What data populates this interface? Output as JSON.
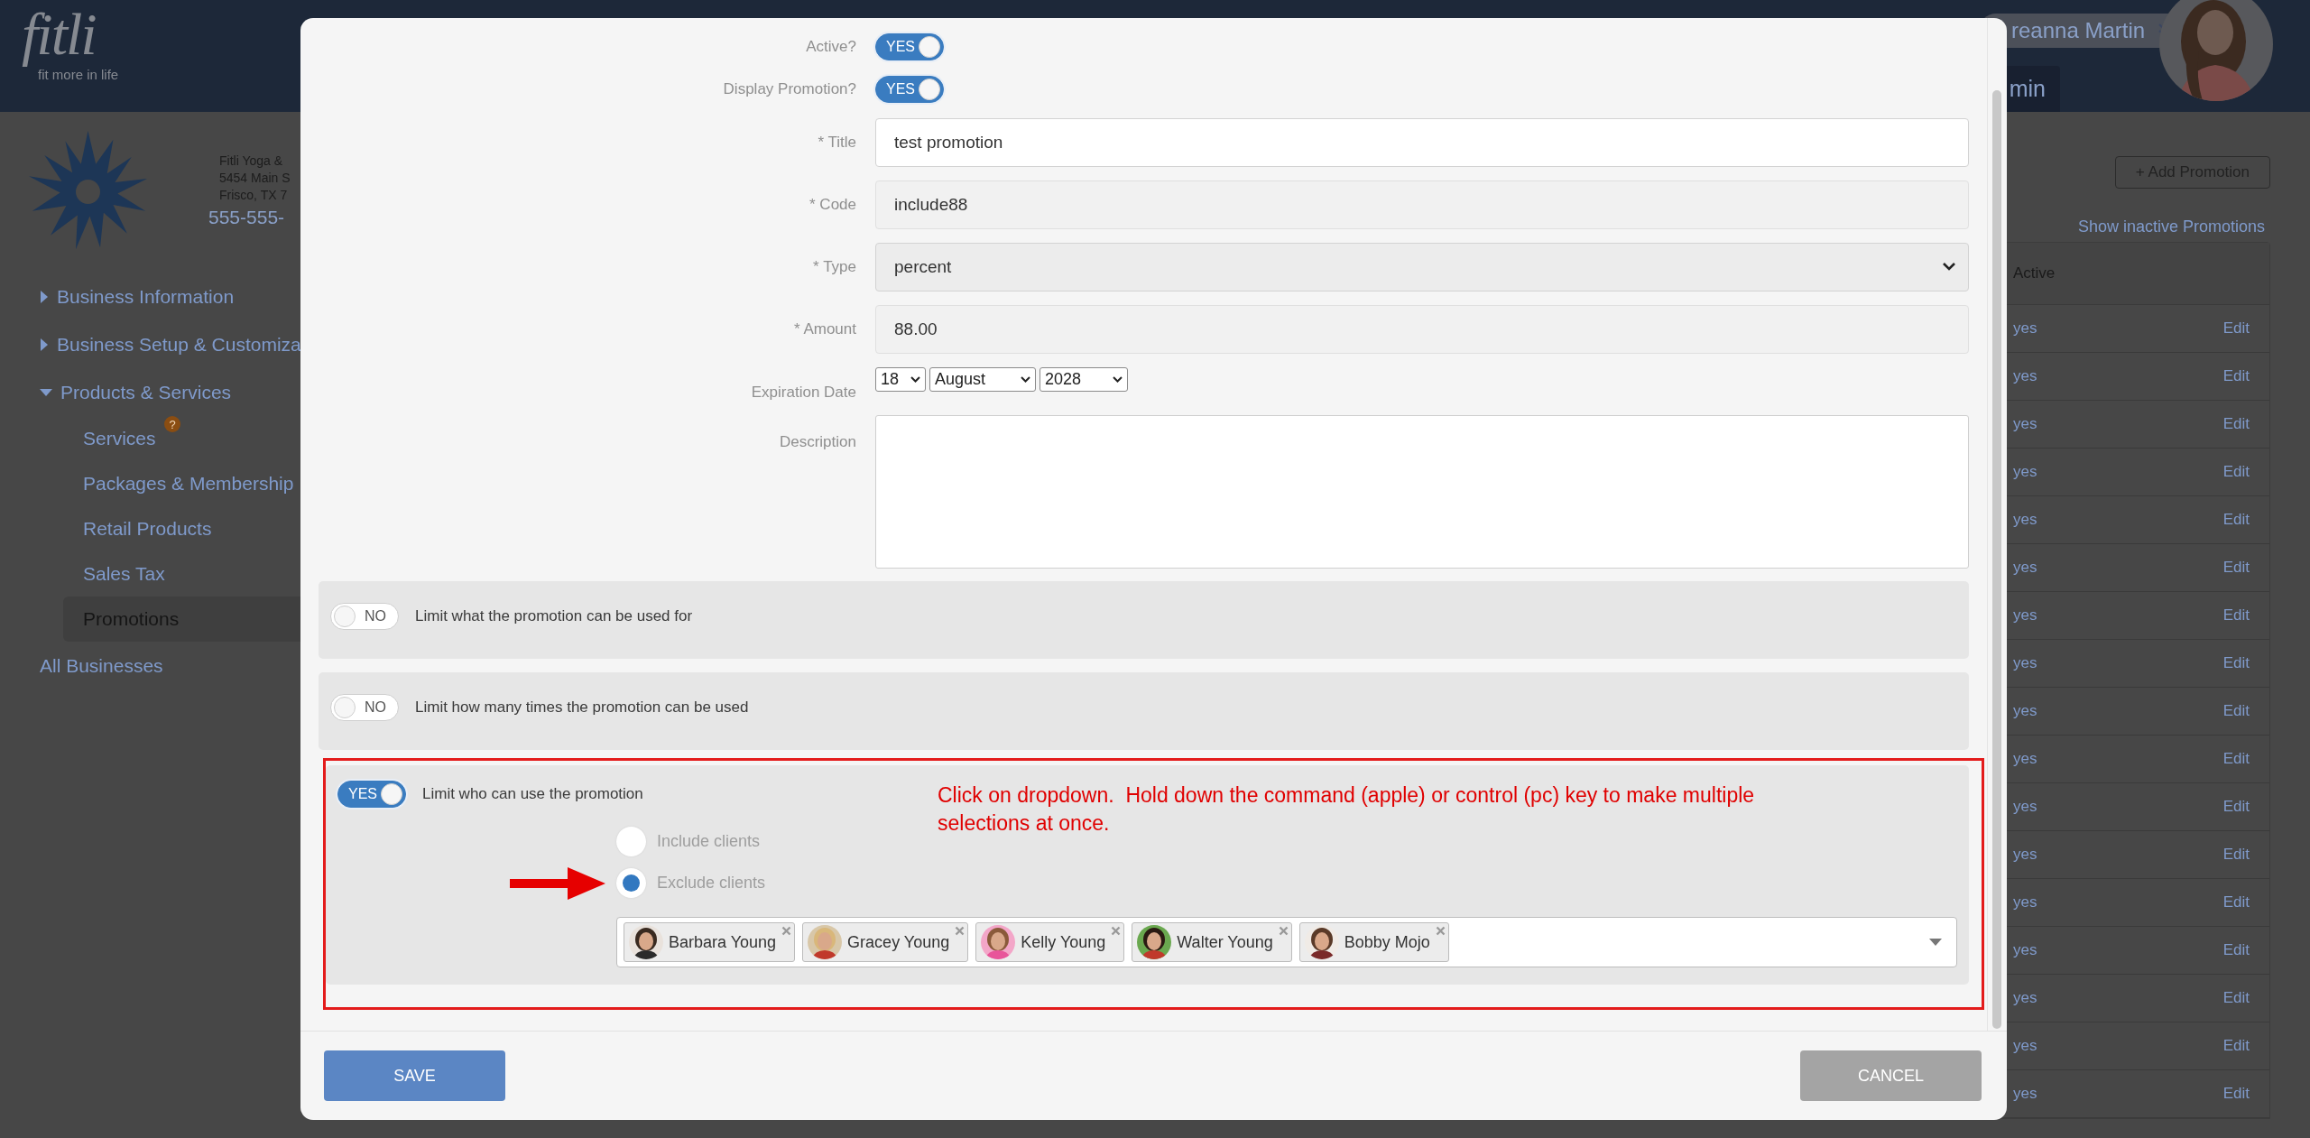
{
  "header": {
    "logo": "fitli",
    "tagline": "fit more in life",
    "user_name": "reanna Martin",
    "nav_tab": "min"
  },
  "business": {
    "lines": [
      "Fitli Yoga &",
      "5454 Main S",
      "Frisco, TX 7"
    ],
    "phone": "555-555-"
  },
  "sidebar": {
    "items": [
      {
        "kind": "section",
        "label": "Business Information",
        "expanded": false
      },
      {
        "kind": "section",
        "label": "Business Setup & Customiza",
        "expanded": false
      },
      {
        "kind": "section",
        "label": "Products & Services",
        "expanded": true,
        "children": [
          {
            "label": "Services",
            "selected": false,
            "badge": "?"
          },
          {
            "label": "Packages & Membership",
            "selected": false
          },
          {
            "label": "Retail Products",
            "selected": false
          },
          {
            "label": "Sales Tax",
            "selected": false
          },
          {
            "label": "Promotions",
            "selected": true
          }
        ]
      },
      {
        "kind": "link",
        "label": "All Businesses"
      }
    ]
  },
  "promotions": {
    "add_button": "+ Add Promotion",
    "inactive_link": "Show inactive Promotions",
    "table": {
      "columns": [
        "Active"
      ],
      "rows": [
        {
          "active": "yes",
          "action": "Edit"
        },
        {
          "active": "yes",
          "action": "Edit"
        },
        {
          "active": "yes",
          "action": "Edit"
        },
        {
          "active": "yes",
          "action": "Edit"
        },
        {
          "active": "yes",
          "action": "Edit"
        },
        {
          "active": "yes",
          "action": "Edit"
        },
        {
          "active": "yes",
          "action": "Edit"
        },
        {
          "active": "yes",
          "action": "Edit"
        },
        {
          "active": "yes",
          "action": "Edit"
        },
        {
          "active": "yes",
          "action": "Edit"
        },
        {
          "active": "yes",
          "action": "Edit"
        },
        {
          "active": "yes",
          "action": "Edit"
        },
        {
          "active": "yes",
          "action": "Edit"
        },
        {
          "active": "yes",
          "action": "Edit"
        },
        {
          "active": "yes",
          "action": "Edit"
        },
        {
          "active": "yes",
          "action": "Edit"
        },
        {
          "active": "yes",
          "action": "Edit"
        }
      ]
    }
  },
  "modal": {
    "fields": [
      {
        "kind": "toggle",
        "label": "Active?",
        "on": true,
        "text": "YES"
      },
      {
        "kind": "toggle",
        "label": "Display Promotion?",
        "on": true,
        "text": "YES"
      },
      {
        "kind": "input",
        "label": "* Title",
        "value": "test promotion",
        "readonly": false
      },
      {
        "kind": "input",
        "label": "* Code",
        "value": "include88",
        "readonly": true
      },
      {
        "kind": "select",
        "label": "* Type",
        "value": "percent"
      },
      {
        "kind": "input",
        "label": "* Amount",
        "value": "88.00",
        "readonly": true
      },
      {
        "kind": "date",
        "label": "Expiration Date",
        "parts": [
          "18",
          "August",
          "2028"
        ]
      },
      {
        "kind": "textarea",
        "label": "Description"
      }
    ],
    "limits": [
      {
        "label": "Limit what the promotion can be used for",
        "on": false,
        "text": "NO",
        "highlighted": false
      },
      {
        "label": "Limit how many times the promotion can be used",
        "on": false,
        "text": "NO",
        "highlighted": false
      },
      {
        "label": "Limit who can use the promotion",
        "on": true,
        "text": "YES",
        "highlighted": true,
        "note": "Click on dropdown.  Hold down the command (apple) or control (pc) key to make multiple selections at once.",
        "options": [
          {
            "label": "Include clients",
            "selected": false
          },
          {
            "label": "Exclude clients",
            "selected": true
          }
        ],
        "clients": [
          "Barbara Young",
          "Gracey Young",
          "Kelly Young",
          "Walter Young",
          "Bobby Mojo"
        ]
      }
    ],
    "buttons": [
      {
        "label": "SAVE",
        "kind": "primary"
      },
      {
        "label": "CANCEL",
        "kind": "secondary"
      }
    ]
  }
}
